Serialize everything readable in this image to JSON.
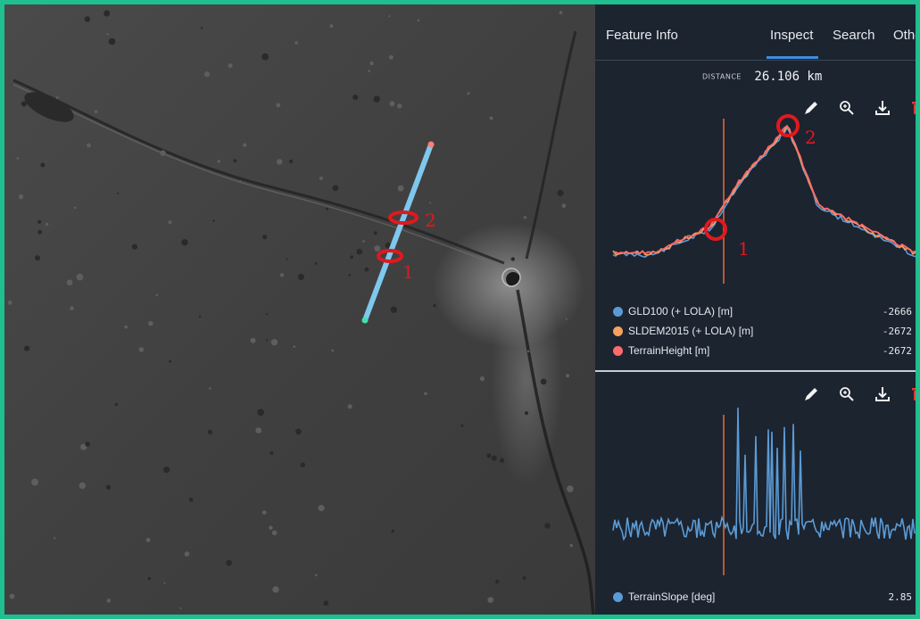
{
  "tabs": [
    {
      "label": "Feature Info",
      "active": false
    },
    {
      "label": "Inspect",
      "active": true
    },
    {
      "label": "Search",
      "active": false
    },
    {
      "label": "Other",
      "active": false
    }
  ],
  "distance": {
    "label": "DISTANCE",
    "value": "26.106 km"
  },
  "map_annotations": {
    "marker_1": "1",
    "marker_2": "2"
  },
  "elevation_chart": {
    "annotation_1": "1",
    "annotation_2": "2",
    "tools": [
      "pencil-icon",
      "zoom-icon",
      "download-icon",
      "trash-icon"
    ],
    "legend": [
      {
        "name": "GLD100 (+ LOLA) [m]",
        "value": "-2666",
        "color": "#5b9bd5"
      },
      {
        "name": "SLDEM2015 (+ LOLA) [m]",
        "value": "-2672",
        "color": "#f5a25d"
      },
      {
        "name": "TerrainHeight [m]",
        "value": "-2672",
        "color": "#ff6b6b"
      }
    ]
  },
  "slope_chart": {
    "tools": [
      "pencil-icon",
      "zoom-icon",
      "download-icon",
      "trash-icon"
    ],
    "legend": [
      {
        "name": "TerrainSlope [deg]",
        "value": "2.85",
        "color": "#5b9bd5"
      }
    ]
  },
  "colors": {
    "accent_border": "#1fbf8f",
    "panel_bg": "#1c2430",
    "active_tab_underline": "#3d8ddf",
    "profile_line": "#7ec8ee",
    "annotation_red": "#e0191e",
    "trash_red": "#e53935"
  }
}
